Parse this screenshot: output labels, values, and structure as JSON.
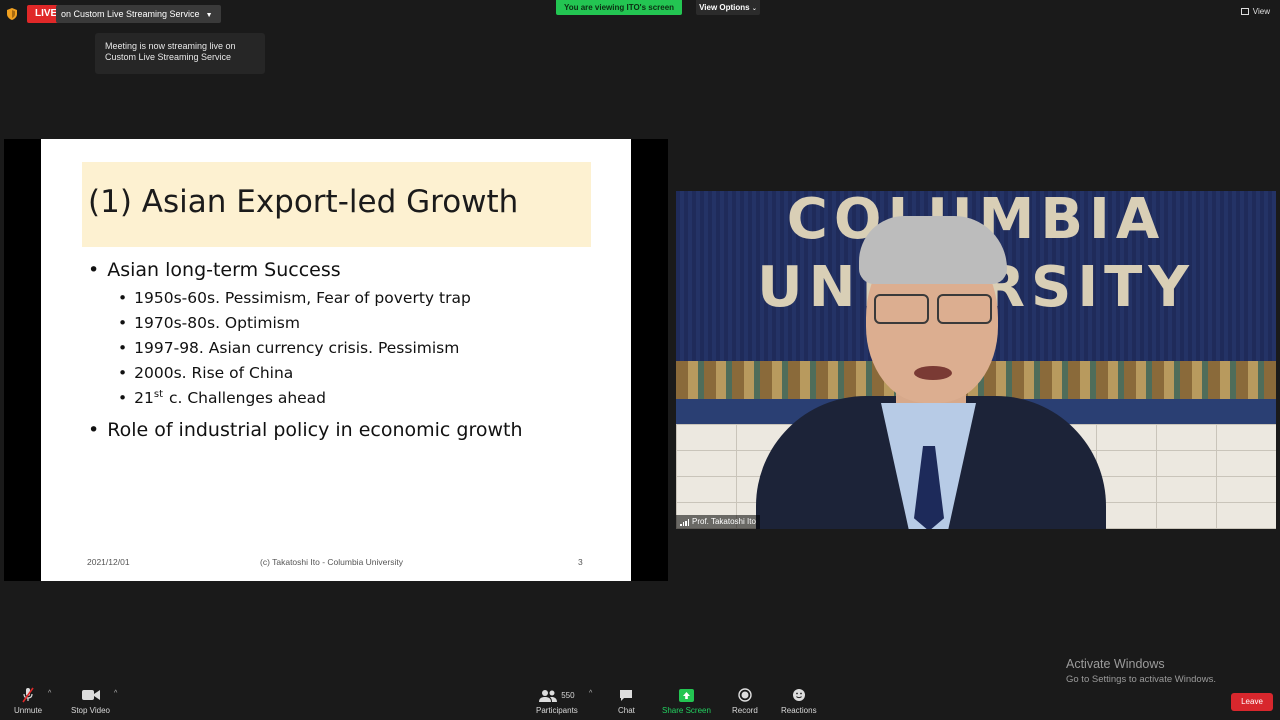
{
  "top_bar": {
    "live_badge": "LIVE",
    "live_service": "on Custom Live Streaming Service",
    "tooltip": "Meeting is now streaming live on Custom Live Streaming Service",
    "viewing_banner": "You are viewing ITO's screen",
    "view_options": "View Options",
    "view_label": "View"
  },
  "slide": {
    "title": "(1) Asian Export-led Growth",
    "bullets": [
      {
        "text": "Asian long-term Success",
        "sub": [
          "1950s-60s. Pessimism, Fear of poverty trap",
          "1970s-80s. Optimism",
          "1997-98. Asian currency crisis. Pessimism",
          "2000s. Rise of China"
        ]
      },
      {
        "text": "Role of industrial policy in economic growth"
      }
    ],
    "sub_last": {
      "num": "21",
      "sup": "st",
      "rest": " c. Challenges ahead"
    },
    "footer": {
      "date": "2021/12/01",
      "copyright": "(c) Takatoshi Ito - Columbia University",
      "page": "3"
    }
  },
  "video": {
    "participant_name": "Prof. Takatoshi Ito",
    "background_text": [
      "COLUMBIA",
      "UNIVERSITY"
    ]
  },
  "watermark": {
    "title": "Activate Windows",
    "subtitle": "Go to Settings to activate Windows."
  },
  "toolbar": {
    "unmute": "Unmute",
    "stop_video": "Stop Video",
    "participants": "Participants",
    "participant_count": "550",
    "chat": "Chat",
    "share_screen": "Share Screen",
    "record": "Record",
    "reactions": "Reactions",
    "leave": "Leave"
  },
  "colors": {
    "live_red": "#e02828",
    "share_green": "#23c552",
    "leave_red": "#d8272d",
    "title_highlight": "#fdf1d1"
  }
}
